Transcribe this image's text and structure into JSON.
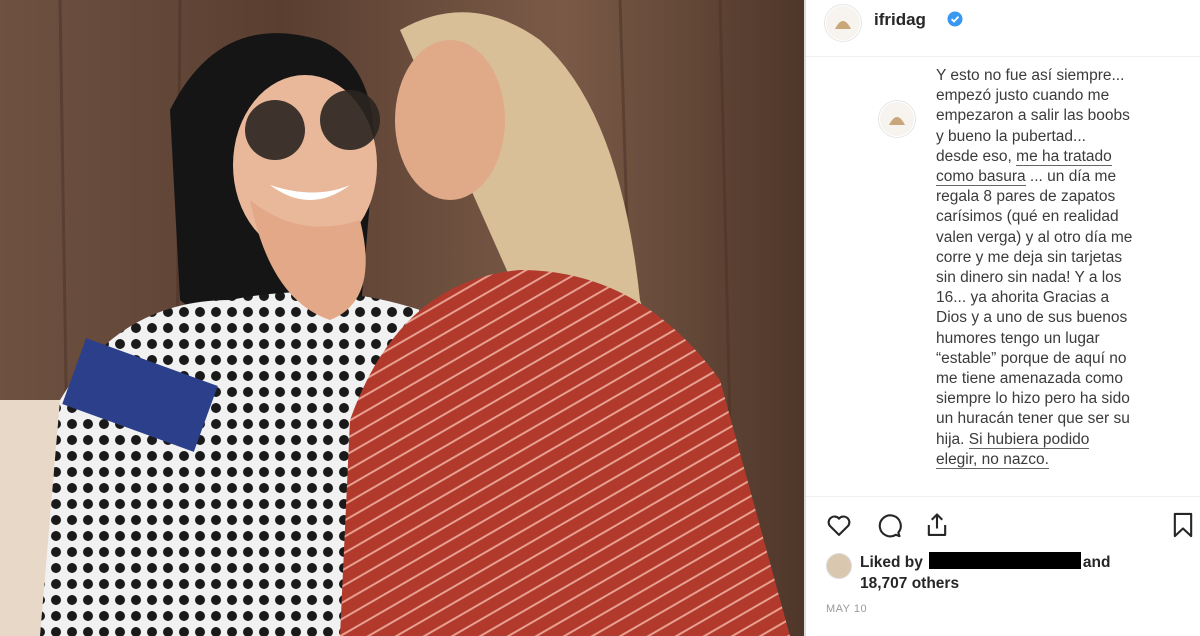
{
  "post": {
    "username": "ifridag",
    "caption_lines": [
      "Y esto no fue así siempre...",
      "empezó justo cuando me",
      "empezaron a salir las boobs",
      "y bueno la pubertad...",
      "desde eso, me ha tratado",
      "como basura ... un día me",
      "regala 8 pares de zapatos",
      "carísimos (qué en realidad",
      "valen verga) y al otro día me",
      "corre y me deja sin tarjetas",
      "sin dinero sin nada! Y a los",
      "16... ya ahorita Gracias a",
      "Dios y a uno de sus buenos",
      "humores tengo un lugar",
      "“estable” porque de aquí no",
      "me tiene amenazada como",
      "siempre lo hizo pero ha sido",
      "un huracán tener que ser su",
      "hija. Si hubiera podido",
      "elegir, no nazco."
    ],
    "liked_by_prefix": "Liked by",
    "liked_by_and": "and",
    "others": "18,707 others",
    "date": "MAY 10"
  },
  "icons": {
    "verified": "verified-badge-icon",
    "like": "heart-icon",
    "comment": "comment-icon",
    "share": "share-icon",
    "save": "bookmark-icon"
  },
  "colors": {
    "verified_blue": "#3897f0",
    "text": "#262626",
    "muted": "#999999"
  }
}
